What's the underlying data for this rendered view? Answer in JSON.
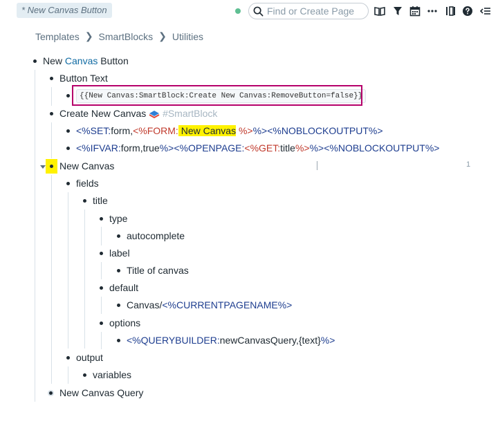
{
  "tab": {
    "title": "* New Canvas Button"
  },
  "search": {
    "placeholder": "Find or Create Page"
  },
  "toolbar": {
    "icons": [
      "book-icon",
      "filter-icon",
      "calendar-icon",
      "more-icon",
      "columns-icon",
      "help-icon",
      "sidebar-toggle-icon"
    ]
  },
  "breadcrumb": {
    "items": [
      "Templates",
      "SmartBlocks",
      "Utilities"
    ]
  },
  "outline": {
    "root": {
      "pre": "New ",
      "link": "Canvas",
      "post": " Button"
    },
    "button_text": "Button Text",
    "code": "{{New Canvas:SmartBlock:Create New Canvas:RemoveButton=false}}",
    "create": {
      "label": "Create New Canvas",
      "tag": "#SmartBlock"
    },
    "line1": {
      "a": "<%SET:",
      "b": "form,",
      "c": "<%FORM:",
      "d": " New Canvas",
      "e": " %>",
      "f": "%>",
      "g": "<%NOBLOCKOUTPUT%>"
    },
    "line2": {
      "a": "<%IFVAR:",
      "b": "form,true",
      "c": "%>",
      "d": "<%OPENPAGE:",
      "e": "<%GET:",
      "f": "title",
      "g": "%>",
      "h": "%>",
      "i": "<%NOBLOCKOUTPUT%>"
    },
    "new_canvas": "New Canvas",
    "ref_count": "1",
    "fields": "fields",
    "title": "title",
    "type": "type",
    "autocomplete": "autocomplete",
    "label": "label",
    "title_of_canvas": "Title of canvas",
    "default": "default",
    "default_val": {
      "a": "Canvas/",
      "b": "<%CURRENTPAGENAME%>"
    },
    "options": "options",
    "options_val": {
      "a": "<%QUERYBUILDER:",
      "b": "newCanvasQuery,{text}",
      "c": "%>"
    },
    "output": "output",
    "variables": "variables",
    "query": "New Canvas Query"
  },
  "colors": {
    "highlight": "#fff200",
    "frame": "#b5006a",
    "macro": "#1d3d8f",
    "macro_accent": "#c0392b",
    "sync": "#5fbf93"
  }
}
